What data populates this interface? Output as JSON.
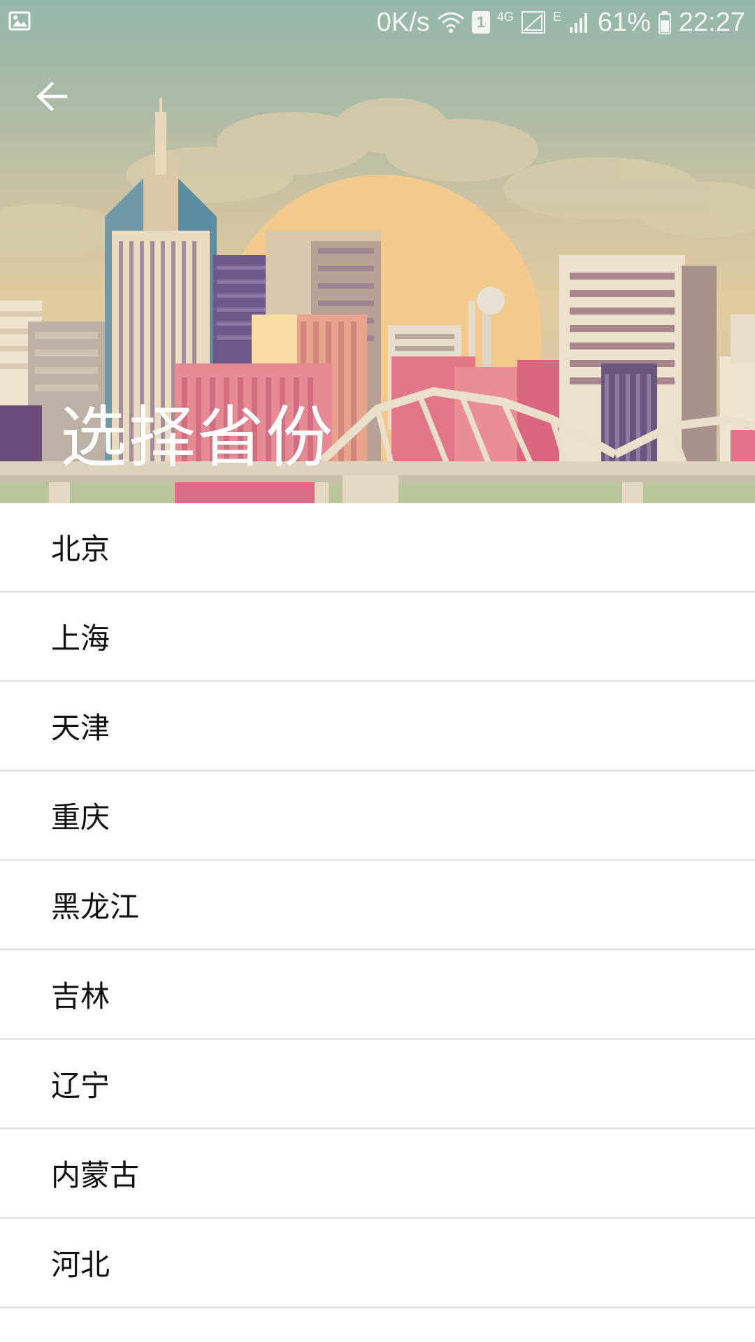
{
  "status_bar": {
    "speed": "0K/s",
    "network_label": "4G",
    "edge_label": "E",
    "sim_badge": "1",
    "battery": "61%",
    "time": "22:27"
  },
  "header": {
    "title": "选择省份"
  },
  "provinces": [
    {
      "label": "北京"
    },
    {
      "label": "上海"
    },
    {
      "label": "天津"
    },
    {
      "label": "重庆"
    },
    {
      "label": "黑龙江"
    },
    {
      "label": "吉林"
    },
    {
      "label": "辽宁"
    },
    {
      "label": "内蒙古"
    },
    {
      "label": "河北"
    }
  ],
  "icons": {
    "back": "arrow-left-icon",
    "gallery": "image-icon",
    "wifi": "wifi-icon",
    "signal": "signal-icon",
    "battery": "battery-icon"
  },
  "colors": {
    "title": "#ffffff",
    "divider": "#e6e6e6",
    "text": "#111111"
  }
}
